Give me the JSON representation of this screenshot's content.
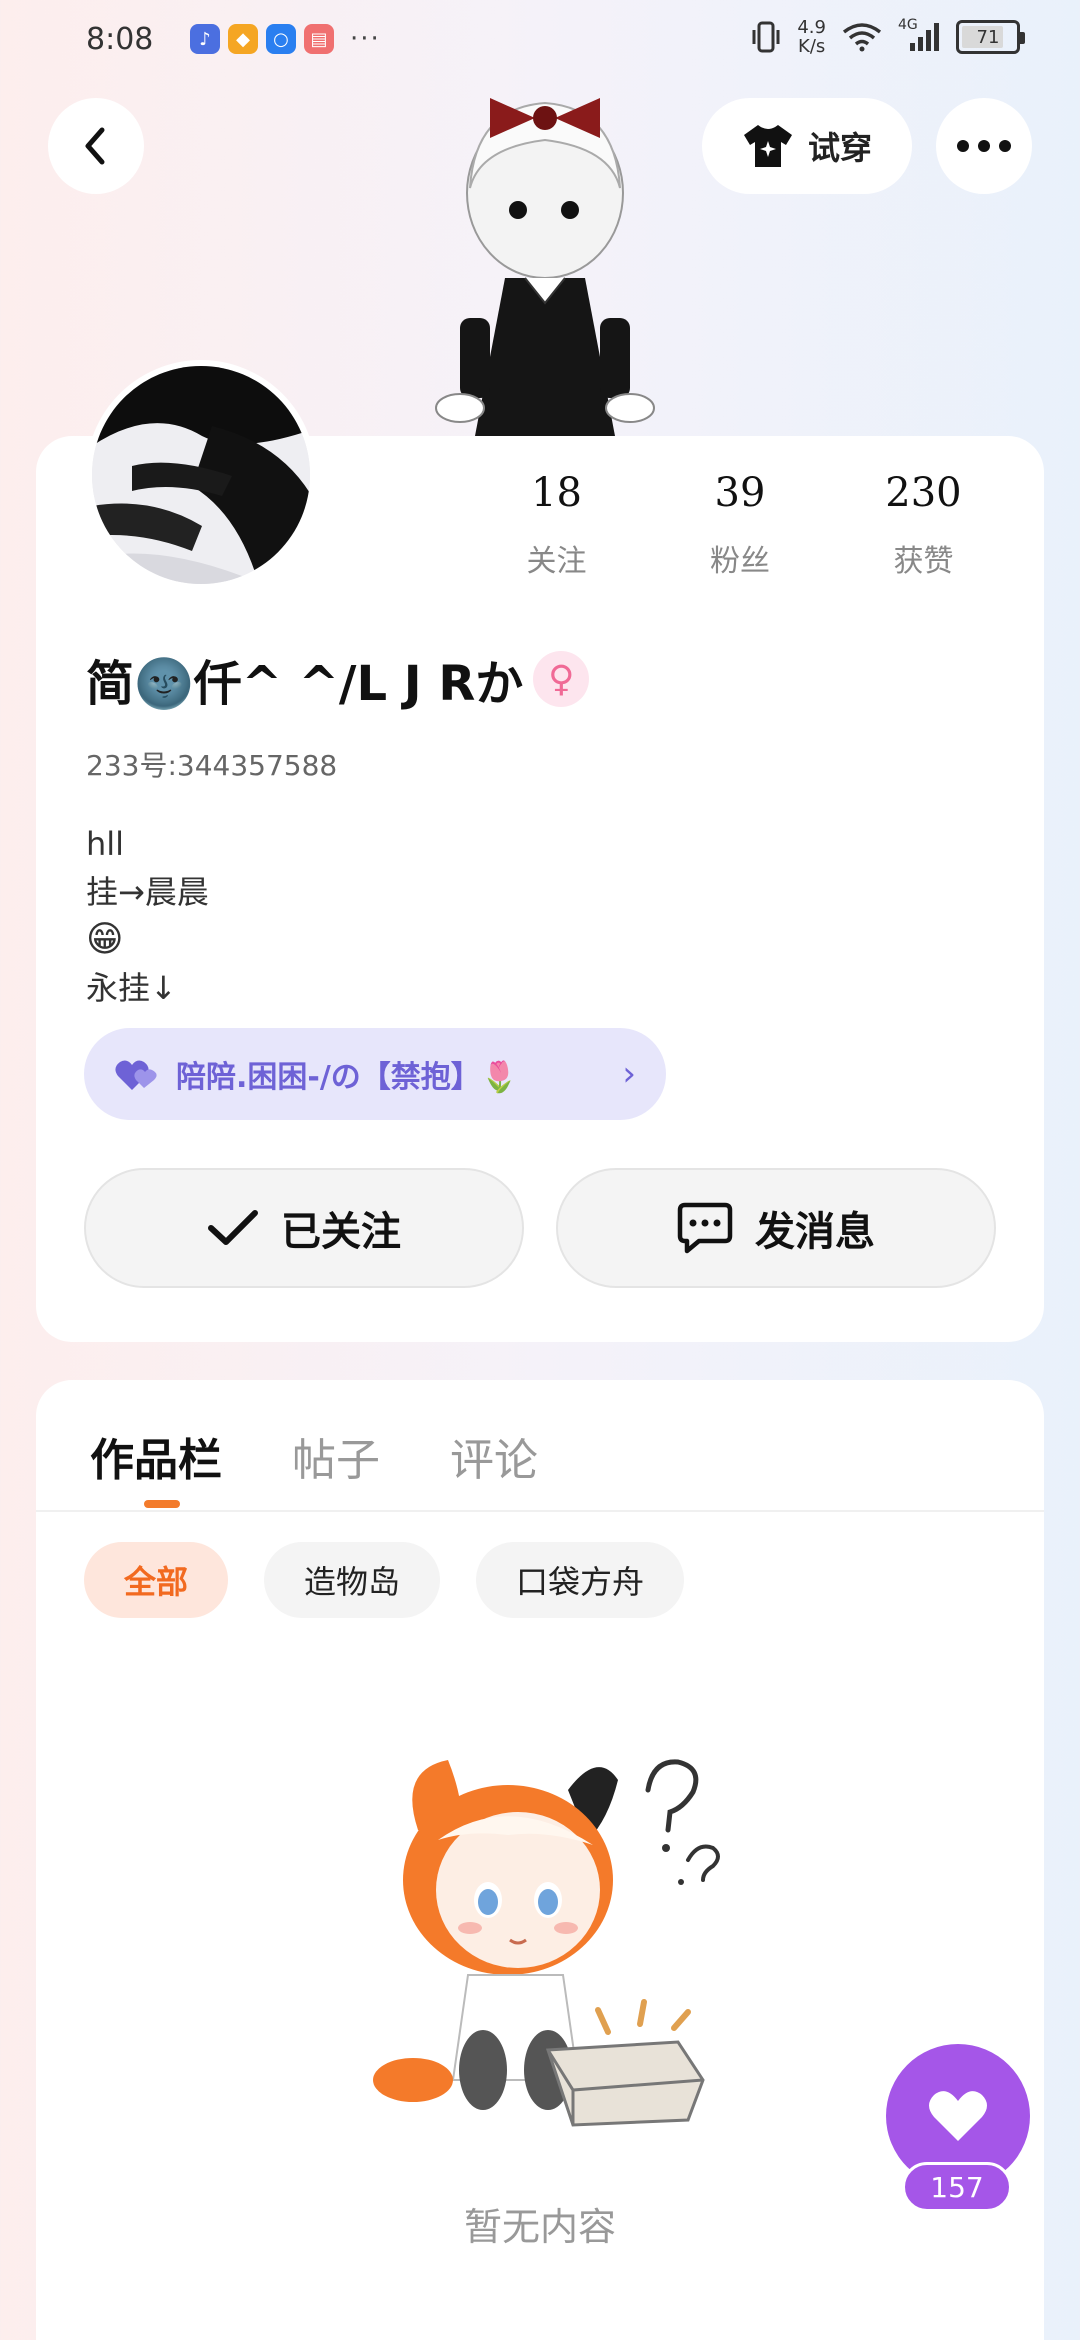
{
  "status_bar": {
    "time": "8:08",
    "net_speed_value": "4.9",
    "net_speed_unit": "K/s",
    "network": "4G",
    "battery": "71",
    "more": "···"
  },
  "header": {
    "tryon_label": "试穿"
  },
  "profile": {
    "stats": [
      {
        "value": "18",
        "label": "关注"
      },
      {
        "value": "39",
        "label": "粉丝"
      },
      {
        "value": "230",
        "label": "获赞"
      }
    ],
    "username": "简🌚仟^ ^/L J Rか",
    "gender_symbol": "♀",
    "uid": "233号:344357588",
    "bio": [
      "hll",
      "挂→晨晨",
      "😁",
      "永挂↓"
    ],
    "pair_chip": {
      "text": "陪陪.困困-/の【禁抱】🌷",
      "chevron": "›"
    },
    "follow_label": "已关注",
    "message_label": "发消息"
  },
  "works": {
    "tabs": [
      "作品栏",
      "帖子",
      "评论"
    ],
    "chips": [
      "全部",
      "造物岛",
      "口袋方舟"
    ],
    "empty_text": "暂无内容"
  },
  "like_fab": {
    "count": "157"
  },
  "colors": {
    "accent_orange": "#f26a20",
    "accent_purple": "#a556e8",
    "chip_purple_bg": "#e7e6fb",
    "chip_purple_text": "#6e62d6"
  },
  "icons": [
    "back-arrow-icon",
    "tshirt-icon",
    "more-dots-icon",
    "heart-icon",
    "check-icon",
    "chat-bubble-icon",
    "female-icon",
    "chevron-right-icon"
  ]
}
